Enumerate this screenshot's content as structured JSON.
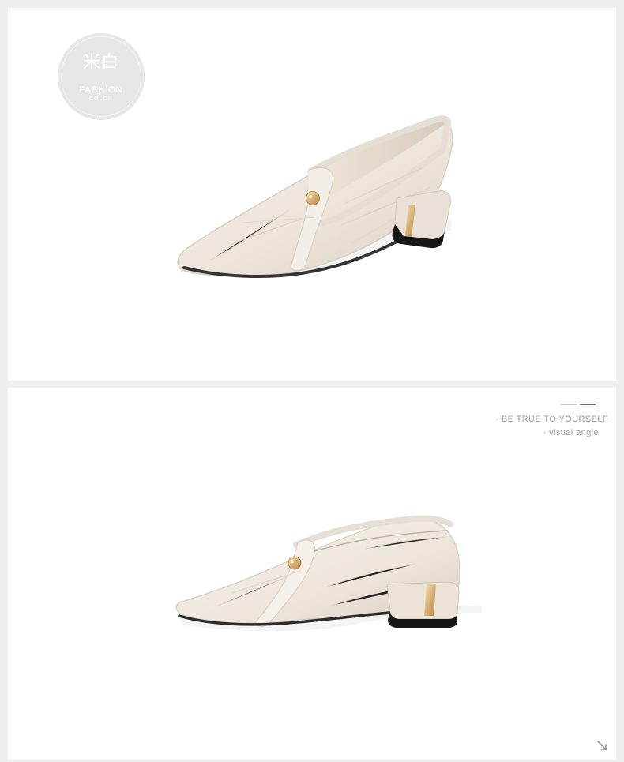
{
  "color_badge": {
    "title": "米白",
    "subtitle": "FASHION",
    "subtitle_small": "COLOR"
  },
  "caption": {
    "line1": "· BE TRUE TO YOURSELF",
    "line2": "· visual angle"
  },
  "icons": {
    "corner": "arrow-down-right-icon"
  },
  "colors": {
    "page_background": "#efefef",
    "panel_background": "#ffffff",
    "shoe_cream": "#efe7dc",
    "gold_accent": "#d6b06d",
    "sole": "#222222"
  }
}
